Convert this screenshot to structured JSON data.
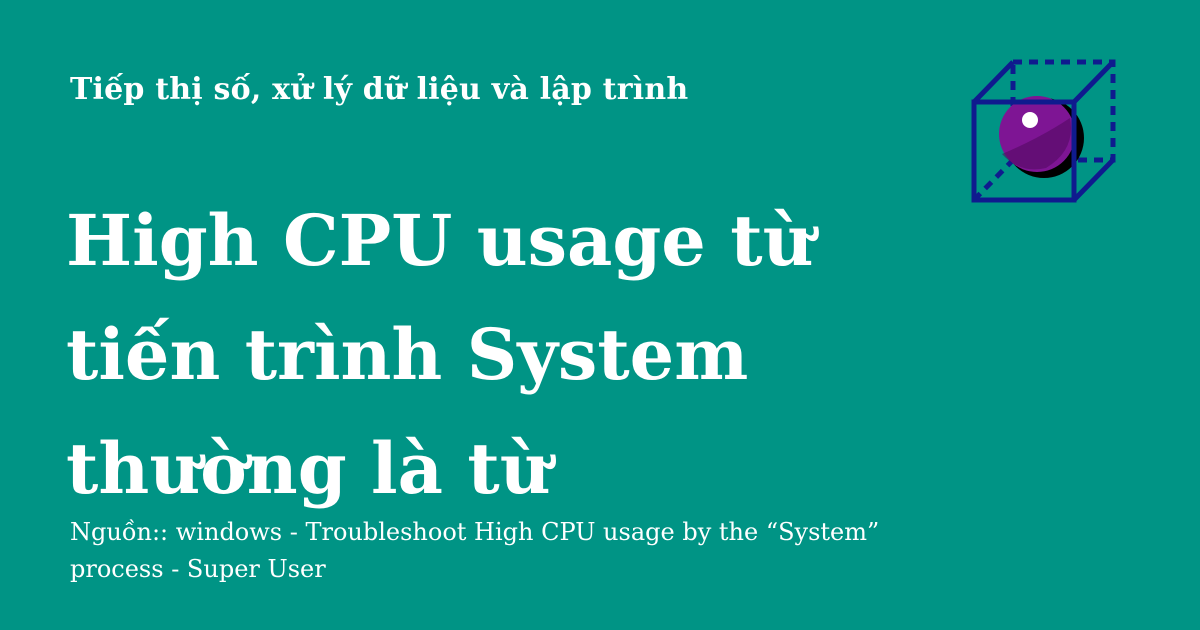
{
  "header": {
    "site_name": "Tiếp thị số, xử lý dữ liệu và lập trình"
  },
  "article": {
    "title": "High CPU usage từ tiến trình System thường là từ",
    "source": "Nguồn:: windows - Troubleshoot High CPU usage by the “System” process - Super User"
  },
  "logo": {
    "icon": "cube-with-sphere-icon"
  },
  "colors": {
    "background": "#009485",
    "text": "#ffffff",
    "cube_stroke": "#0f1b8e",
    "sphere": "#7e1594",
    "sphere_shade": "#4f0a5c",
    "sphere_shadow": "#000000"
  }
}
